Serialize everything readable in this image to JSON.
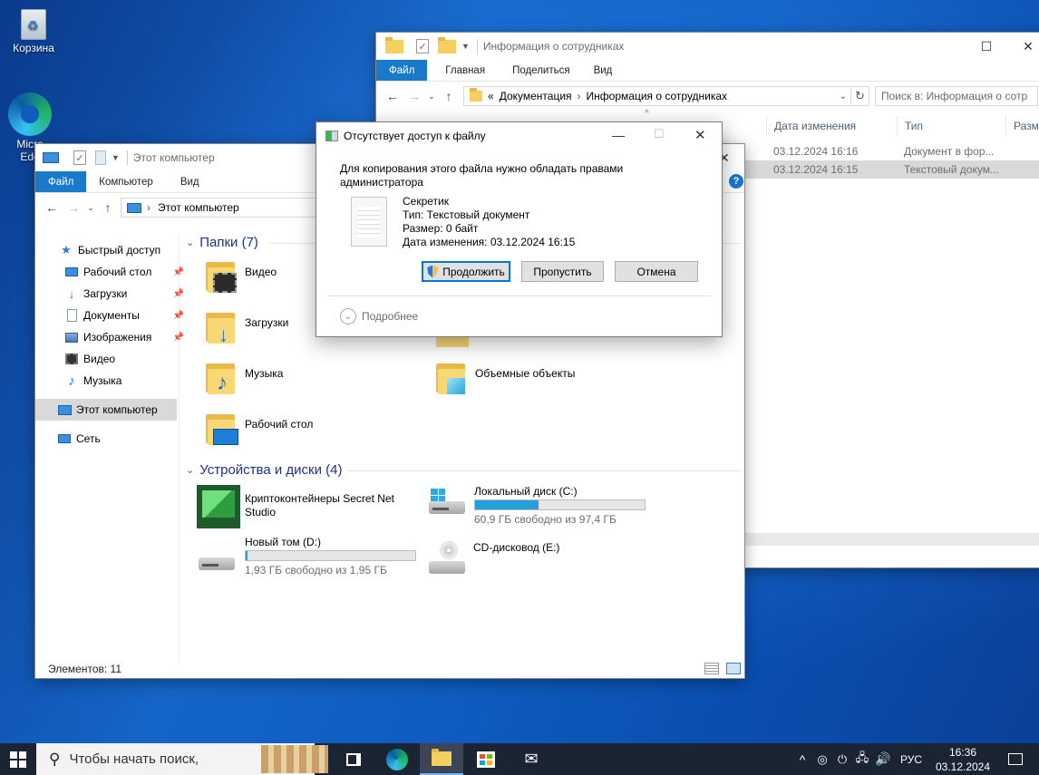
{
  "desktop": {
    "icons": [
      {
        "label": "Корзина"
      },
      {
        "label": "Micro\nEdg"
      }
    ]
  },
  "back_window": {
    "title": "Информация о сотрудниках",
    "tabs": [
      "Файл",
      "Главная",
      "Поделиться",
      "Вид"
    ],
    "breadcrumb": [
      "«",
      "Документация",
      "Информация о сотрудниках"
    ],
    "search_placeholder": "Поиск в: Информация о сотр",
    "columns": [
      "Дата изменения",
      "Тип",
      "Разме"
    ],
    "rows": [
      {
        "date": "03.12.2024 16:16",
        "type": "Документ в фор..."
      },
      {
        "date": "03.12.2024 16:15",
        "type": "Текстовый докум..."
      }
    ]
  },
  "front_window": {
    "title": "Этот компьютер",
    "tabs": [
      "Файл",
      "Компьютер",
      "Вид"
    ],
    "breadcrumb": "Этот компьютер",
    "sidebar": [
      {
        "label": "Быстрый доступ",
        "icon": "star-icon"
      },
      {
        "label": "Рабочий стол",
        "icon": "desktop-icon"
      },
      {
        "label": "Загрузки",
        "icon": "download-icon"
      },
      {
        "label": "Документы",
        "icon": "document-icon"
      },
      {
        "label": "Изображения",
        "icon": "image-icon"
      },
      {
        "label": "Видео",
        "icon": "video-icon"
      },
      {
        "label": "Музыка",
        "icon": "music-icon"
      },
      {
        "label": "Этот компьютер",
        "icon": "computer-icon"
      },
      {
        "label": "Сеть",
        "icon": "network-icon"
      }
    ],
    "folders_header": "Папки (7)",
    "folders": [
      "Видео",
      "Загрузки",
      "Музыка",
      "Рабочий стол",
      "Объемные объекты"
    ],
    "devices_header": "Устройства и диски (4)",
    "devices": {
      "crypto_line1": "Криптоконтейнеры Secret Net",
      "crypto_line2": "Studio",
      "c_name": "Локальный диск (C:)",
      "c_sub": "60,9 ГБ свободно из 97,4 ГБ",
      "c_used": 0.375,
      "d_name": "Новый том (D:)",
      "d_sub": "1,93 ГБ свободно из 1,95 ГБ",
      "d_used": 0.01,
      "e_name": "CD-дисковод (E:)"
    },
    "status": "Элементов: 11"
  },
  "dialog": {
    "title": "Отсутствует доступ к файлу",
    "message": "Для копирования этого файла нужно обладать правами администратора",
    "file_name": "Секретик",
    "file_type": "Тип: Текстовый документ",
    "file_size": "Размер: 0 байт",
    "file_date": "Дата изменения: 03.12.2024 16:15",
    "btn_continue": "Продолжить",
    "btn_skip": "Пропустить",
    "btn_cancel": "Отмена",
    "details": "Подробнее"
  },
  "taskbar": {
    "search_placeholder": "Чтобы начать поиск,",
    "lang": "РУС",
    "time": "16:36",
    "date": "03.12.2024"
  }
}
